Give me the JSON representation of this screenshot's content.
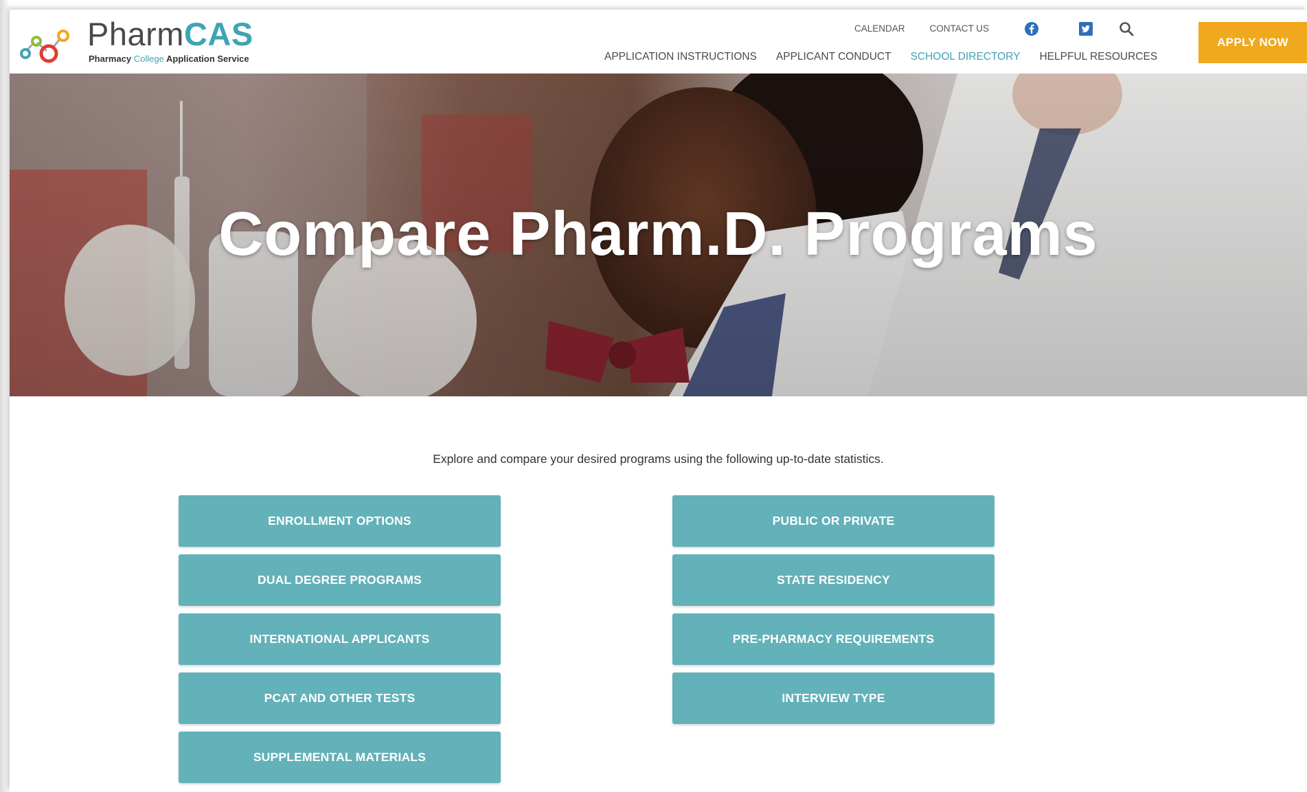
{
  "logo": {
    "word_pharm": "Pharm",
    "word_cas": "CAS",
    "tag_pharmacy": "Pharmacy ",
    "tag_college": "College",
    "tag_rest": " Application Service"
  },
  "util_nav": {
    "calendar": "CALENDAR",
    "contact": "CONTACT US"
  },
  "main_nav": {
    "items": [
      {
        "label": "APPLICATION INSTRUCTIONS"
      },
      {
        "label": "APPLICANT CONDUCT"
      },
      {
        "label": "SCHOOL DIRECTORY"
      },
      {
        "label": "HELPFUL RESOURCES"
      }
    ]
  },
  "apply_label": "APPLY NOW",
  "hero": {
    "title": "Compare Pharm.D. Programs"
  },
  "intro": "Explore and compare your desired programs using the following up-to-date statistics.",
  "buttons": {
    "left": [
      {
        "label": "ENROLLMENT OPTIONS"
      },
      {
        "label": "DUAL DEGREE PROGRAMS"
      },
      {
        "label": "INTERNATIONAL APPLICANTS"
      },
      {
        "label": "PCAT AND OTHER TESTS"
      },
      {
        "label": "SUPPLEMENTAL MATERIALS"
      }
    ],
    "right": [
      {
        "label": "PUBLIC OR PRIVATE"
      },
      {
        "label": "STATE RESIDENCY"
      },
      {
        "label": "PRE-PHARMACY REQUIREMENTS"
      },
      {
        "label": "INTERVIEW TYPE"
      }
    ]
  },
  "colors": {
    "accent": "#3fa4b4",
    "button": "#63b1b9",
    "apply": "#f0a81d"
  },
  "icons": {
    "facebook": "facebook-icon",
    "twitter": "twitter-icon",
    "search": "search-icon",
    "logo": "molecule-logo-icon"
  }
}
